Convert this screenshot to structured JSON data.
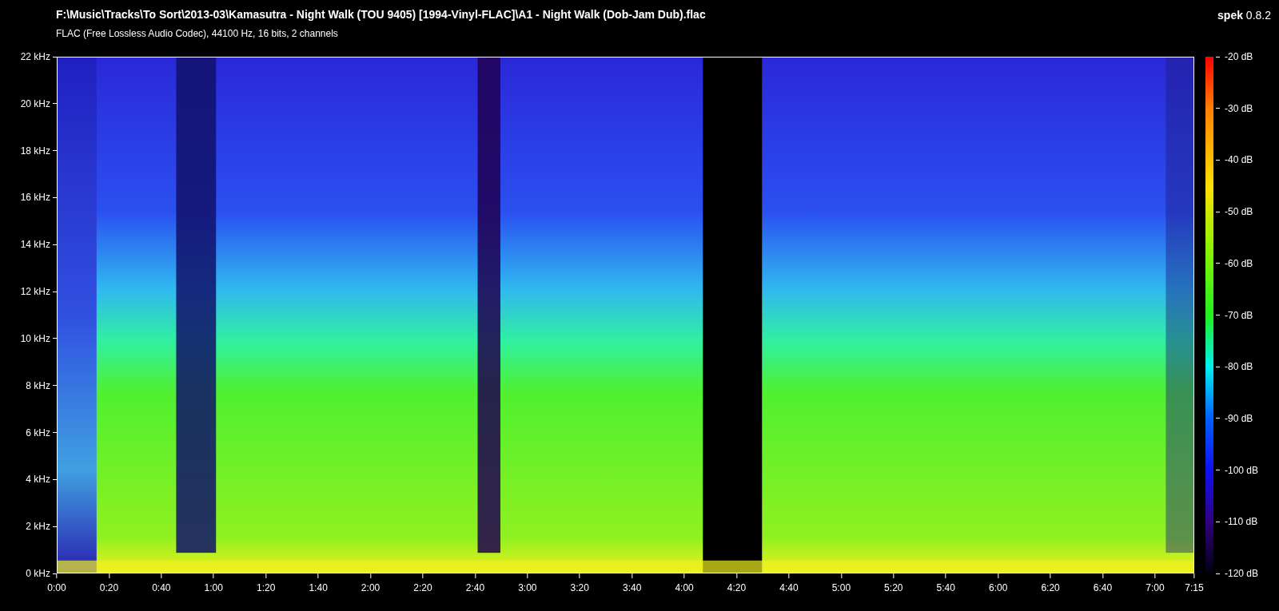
{
  "header": {
    "file_path": "F:\\Music\\Tracks\\To Sort\\2013-03\\Kamasutra - Night Walk (TOU 9405) [1994-Vinyl-FLAC]\\A1 - Night Walk (Dob-Jam Dub).flac",
    "codec_info": "FLAC (Free Lossless Audio Codec), 44100 Hz, 16 bits, 2 channels",
    "app_name": "**spek** 0.8.2"
  },
  "frequency_axis": [
    "22 kHz",
    "20 kHz",
    "18 kHz",
    "16 kHz",
    "14 kHz",
    "12 kHz",
    "10 kHz",
    "8 kHz",
    "6 kHz",
    "4 kHz",
    "2 kHz",
    "0 kHz"
  ],
  "time_axis": [
    "0:00",
    "0:20",
    "0:40",
    "1:00",
    "1:20",
    "1:40",
    "2:00",
    "2:20",
    "2:40",
    "3:00",
    "3:20",
    "3:40",
    "4:00",
    "4:20",
    "4:40",
    "5:00",
    "5:20",
    "5:40",
    "6:00",
    "6:20",
    "6:40",
    "7:00",
    "7:15"
  ],
  "color_scale": [
    "-20 dB",
    "-30 dB",
    "-40 dB",
    "-50 dB",
    "-60 dB",
    "-70 dB",
    "-80 dB",
    "-90 dB",
    "-100 dB",
    "-110 dB",
    "-120 dB"
  ]
}
